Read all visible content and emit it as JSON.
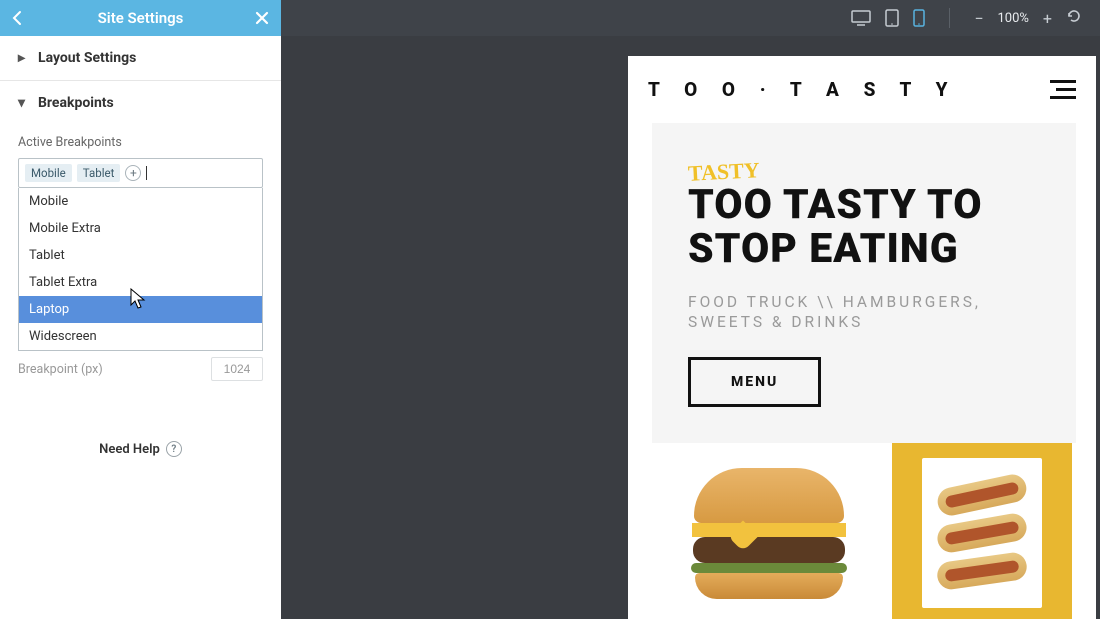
{
  "panel": {
    "title": "Site Settings",
    "sections": {
      "layout": {
        "title": "Layout Settings"
      },
      "breakpoints": {
        "title": "Breakpoints",
        "active_label": "Active Breakpoints",
        "tags": [
          "Mobile",
          "Tablet"
        ],
        "options": [
          "Mobile",
          "Mobile Extra",
          "Tablet",
          "Tablet Extra",
          "Laptop",
          "Widescreen"
        ],
        "selected_option": "Laptop",
        "bp_label": "Breakpoint (px)",
        "bp_value": "1024"
      }
    },
    "need_help": "Need Help"
  },
  "topbar": {
    "devices": [
      "desktop",
      "tablet",
      "mobile"
    ],
    "active_device": "mobile",
    "zoom": {
      "level": "100%",
      "minus": "−",
      "plus": "+"
    }
  },
  "preview": {
    "logo": "T O O · T A S T Y",
    "hero": {
      "script": "TASTY",
      "title_line1": "TOO TASTY TO",
      "title_line2": "STOP EATING",
      "subtitle": "FOOD TRUCK \\\\ HAMBURGERS, SWEETS & DRINKS",
      "menu_btn": "MENU"
    }
  }
}
